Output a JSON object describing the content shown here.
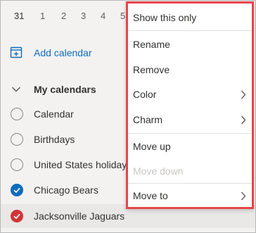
{
  "mini_calendar": {
    "dates": [
      "31",
      "1",
      "2",
      "3",
      "4",
      "5"
    ]
  },
  "sidebar": {
    "add_calendar": "Add calendar",
    "my_calendars": "My calendars",
    "calendars": [
      {
        "label": "Calendar",
        "checked": false
      },
      {
        "label": "Birthdays",
        "checked": false
      },
      {
        "label": "United States holidays",
        "checked": false
      },
      {
        "label": "Chicago Bears",
        "checked": true,
        "color": "#0f6cbd"
      },
      {
        "label": "Jacksonville Jaguars",
        "checked": true,
        "color": "#d13438"
      }
    ]
  },
  "more_button": {
    "label": "···"
  },
  "context_menu": {
    "items": [
      {
        "label": "Show this only"
      },
      {
        "label": "Rename"
      },
      {
        "label": "Remove"
      },
      {
        "label": "Color",
        "submenu": true
      },
      {
        "label": "Charm",
        "submenu": true
      },
      {
        "label": "Move up"
      },
      {
        "label": "Move down",
        "disabled": true
      },
      {
        "label": "Move to",
        "submenu": true
      }
    ]
  },
  "colors": {
    "accent": "#0f6cbd",
    "highlight_border": "#e8454a",
    "more_button_bg": "#9fd8e6",
    "arrow": "#e8454a"
  }
}
